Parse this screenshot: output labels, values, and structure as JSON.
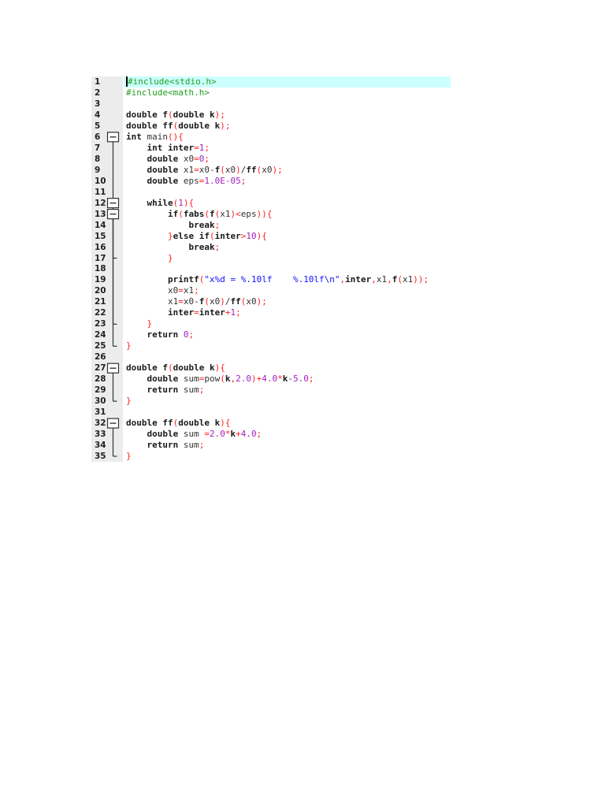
{
  "editor": {
    "highlight_line": 1,
    "lines": [
      "#include<stdio.h>",
      "#include<math.h>",
      "",
      "double f(double k);",
      "double ff(double k);",
      "int main(){",
      "    int inter=1;",
      "    double x0=0;",
      "    double x1=x0-f(x0)/ff(x0);",
      "    double eps=1.0E-05;",
      "",
      "    while(1){",
      "        if(fabs(f(x1)<eps)){",
      "            break;",
      "        }else if(inter>10){",
      "            break;",
      "        }",
      "",
      "        printf(\"x%d = %.10lf    %.10lf\\n\",inter,x1,f(x1));",
      "        x0=x1;",
      "        x1=x0-f(x0)/ff(x0);",
      "        inter=inter+1;",
      "    }",
      "    return 0;",
      "}",
      "",
      "double f(double k){",
      "    double sum=pow(k,2.0)+4.0*k-5.0;",
      "    return sum;",
      "}",
      "",
      "double ff(double k){",
      "    double sum =2.0*k+4.0;",
      "    return sum;",
      "}"
    ],
    "folds": [
      {
        "start": 6,
        "end": 25
      },
      {
        "start": 12,
        "end": 23
      },
      {
        "start": 13,
        "end": 17
      },
      {
        "start": 27,
        "end": 30
      },
      {
        "start": 32,
        "end": 35
      }
    ],
    "colors": {
      "highlight": "#ccffff",
      "keyword": "#1a1a1a",
      "operator": "#ff2020",
      "number": "#a020c0",
      "string": "#1010ff",
      "preprocessor": "#20a020"
    }
  }
}
